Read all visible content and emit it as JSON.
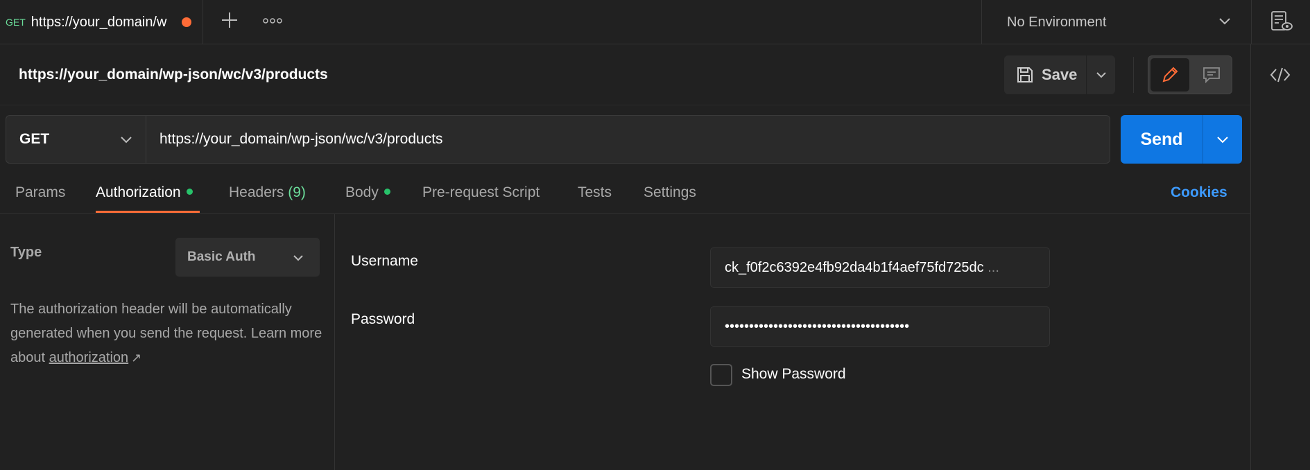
{
  "tab": {
    "method": "GET",
    "title": "https://your_domain/w",
    "modified_color": "#ff6c37"
  },
  "environment": {
    "selected": "No Environment"
  },
  "request": {
    "name": "https://your_domain/wp-json/wc/v3/products",
    "method": "GET",
    "url": "https://your_domain/wp-json/wc/v3/products"
  },
  "toolbar": {
    "save_label": "Save",
    "send_label": "Send"
  },
  "tabs": {
    "params": "Params",
    "authorization": "Authorization",
    "headers": "Headers",
    "headers_count": "(9)",
    "body": "Body",
    "prerequest": "Pre-request Script",
    "tests": "Tests",
    "settings": "Settings",
    "cookies": "Cookies"
  },
  "auth": {
    "type_label": "Type",
    "type_value": "Basic Auth",
    "help_text": "The authorization header will be automatically generated when you send the request. Learn more about",
    "help_link": "authorization",
    "help_arrow": "↗",
    "username_label": "Username",
    "username_value": "ck_f0f2c6392e4fb92da4b1f4aef75fd725dc",
    "username_ellipsis": "...",
    "password_label": "Password",
    "password_value": "••••••••••••••••••••••••••••••••••••••",
    "show_password_label": "Show Password"
  },
  "colors": {
    "accent_orange": "#ff6c37",
    "send_blue": "#0f77e3",
    "green": "#27c26a",
    "link_blue": "#3d9bff"
  }
}
